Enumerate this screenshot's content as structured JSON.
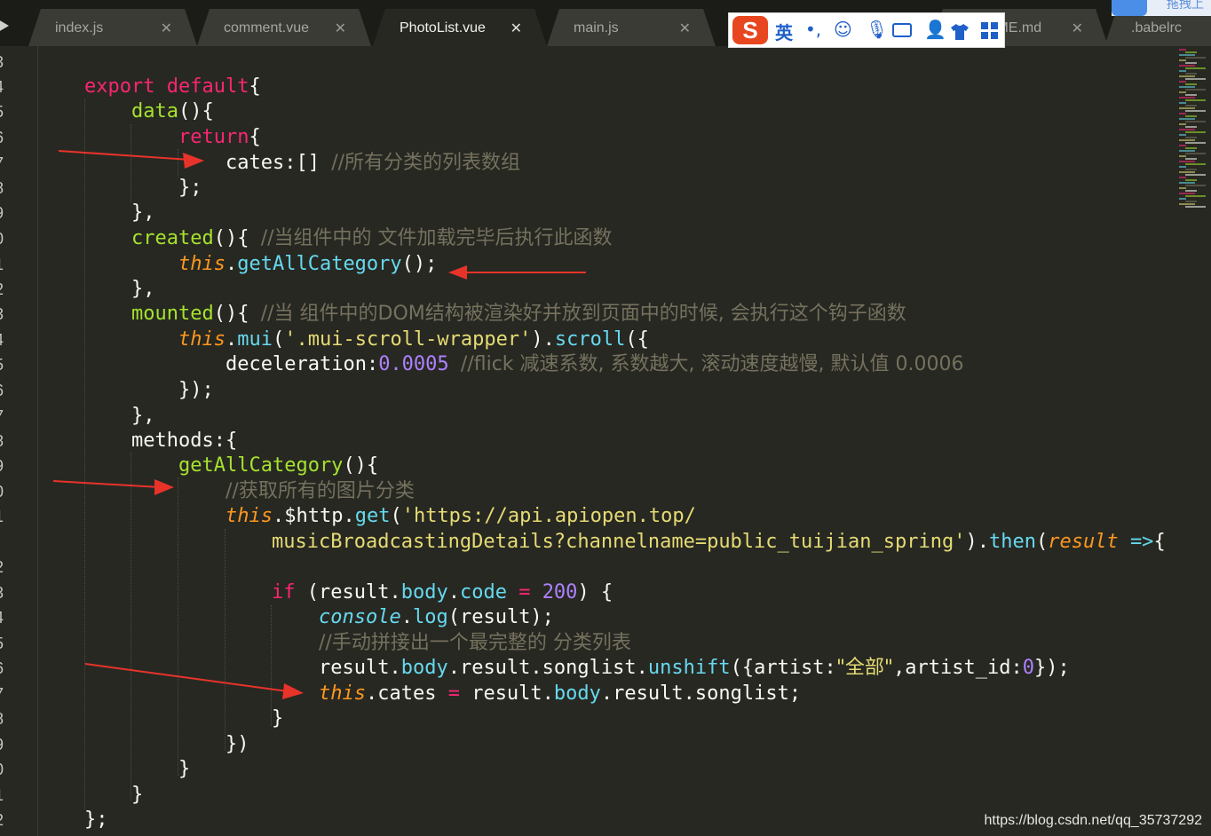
{
  "tabs": [
    {
      "label": "index.js",
      "close": "✕",
      "active": false
    },
    {
      "label": "comment.vue",
      "close": "✕",
      "active": false
    },
    {
      "label": "PhotoList.vue",
      "close": "✕",
      "active": true
    },
    {
      "label": "main.js",
      "close": "✕",
      "active": false
    },
    {
      "label": "README.md",
      "close": "✕",
      "active": false
    },
    {
      "label": ".babelrc",
      "close": "",
      "active": false
    }
  ],
  "ime_toolbar": {
    "logo": "S",
    "language": "英",
    "punctuation": "•,",
    "icons": [
      "emoji-icon",
      "microphone-icon",
      "keyboard-icon",
      "user-icon",
      "skin-shirt-icon",
      "toolbox-icon"
    ]
  },
  "corner_widget": {
    "text": "拖拽上"
  },
  "line_numbers": [
    "3",
    "4",
    "5",
    "6",
    "7",
    "8",
    "9",
    "0",
    "1",
    "2",
    "3",
    "4",
    "5",
    "6",
    "7",
    "8",
    "9",
    "0",
    "1",
    "",
    "2",
    "3",
    "4",
    "5",
    "6",
    "7",
    "8",
    "9",
    "0",
    "1",
    "2"
  ],
  "code": {
    "l4_export": "export",
    "l4_default": "default",
    "l4_brace": "{",
    "l5_data": "data",
    "l5_paren": "(){",
    "l6_return": "return",
    "l6_brace": "{",
    "l7_cates": "cates:[] ",
    "l7_comment": "//所有分类的列表数组",
    "l8": "};",
    "l9": "},",
    "l10_created": "created",
    "l10_paren": "(){ ",
    "l10_comment": "//当组件中的 文件加载完毕后执行此函数",
    "l11_this": "this",
    "l11_dot": ".",
    "l11_fn": "getAllCategory",
    "l11_end": "();",
    "l12": "},",
    "l13_mounted": "mounted",
    "l13_paren": "(){ ",
    "l13_comment": "//当 组件中的DOM结构被渲染好并放到页面中的时候, 会执行这个钩子函数",
    "l14_this": "this",
    "l14_dot": ".",
    "l14_mui": "mui",
    "l14_open": "(",
    "l14_str": "'.mui-scroll-wrapper'",
    "l14_close": ").",
    "l14_scroll": "scroll",
    "l14_end": "({",
    "l15_key": "deceleration:",
    "l15_num": "0.0005",
    "l15_sp": " ",
    "l15_comment": "//flick 减速系数, 系数越大, 滚动速度越慢, 默认值 0.0006",
    "l16": "});",
    "l17": "},",
    "l18": "methods:{",
    "l19_fn": "getAllCategory",
    "l19_end": "(){",
    "l20_comment": "//获取所有的图片分类",
    "l21_this": "this",
    "l21_http": ".$http.",
    "l21_get": "get",
    "l21_open": "(",
    "l21_str": "'https://api.apiopen.top/",
    "l21b_str": "musicBroadcastingDetails?channelname=public_tuijian_spring'",
    "l21b_close": ").",
    "l21b_then": "then",
    "l21b_open": "(",
    "l21b_result": "result",
    "l21b_sp": " ",
    "l21b_arrow": "=>",
    "l21b_brace": "{",
    "l23_if": "if",
    "l23_open": " (result.",
    "l23_body": "body",
    "l23_dot": ".",
    "l23_code": "code",
    "l23_sp": " ",
    "l23_eq": "=",
    "l23_sp2": " ",
    "l23_num": "200",
    "l23_end": ") {",
    "l24_console": "console",
    "l24_dot": ".",
    "l24_log": "log",
    "l24_end": "(result);",
    "l25_comment": "//手动拼接出一个最完整的 分类列表",
    "l26_a": "result.",
    "l26_body": "body",
    "l26_b": ".result.songlist.",
    "l26_unshift": "unshift",
    "l26_c": "({artist:",
    "l26_str": "\"全部\"",
    "l26_d": ",artist_id:",
    "l26_num": "0",
    "l26_e": "});",
    "l27_this": "this",
    "l27_a": ".cates ",
    "l27_eq": "=",
    "l27_b": " result.",
    "l27_body": "body",
    "l27_c": ".result.songlist;",
    "l28": "}",
    "l29": "})",
    "l30": "}",
    "l31": "}",
    "l32": "};"
  },
  "watermark": "https://blog.csdn.net/qq_35737292",
  "colors": {
    "background": "#272822",
    "keyword": "#f92672",
    "function": "#a6e22e",
    "string": "#e6db74",
    "number": "#ae81ff",
    "comment": "#75715e",
    "arrow": "#e8332a"
  }
}
